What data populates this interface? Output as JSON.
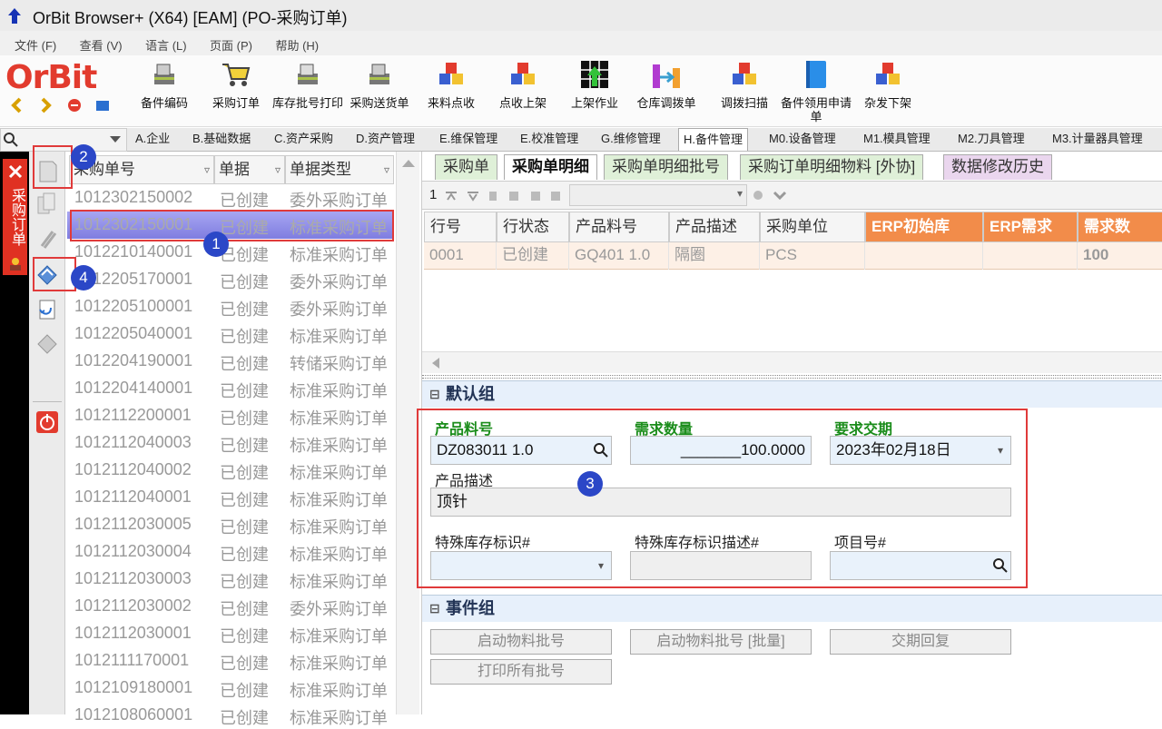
{
  "window": {
    "title": "OrBit Browser+ (X64) [EAM] (PO-采购订单)"
  },
  "menu": [
    "文件 (F)",
    "查看 (V)",
    "语言 (L)",
    "页面 (P)",
    "帮助 (H)"
  ],
  "logo": "OrBit",
  "toolbar": [
    {
      "label": "备件编码",
      "icon": "scanner-icon"
    },
    {
      "label": "采购订单",
      "icon": "cart-icon"
    },
    {
      "label": "库存批号打印",
      "icon": "print-scanner-icon"
    },
    {
      "label": "采购送货单",
      "icon": "scanner-icon"
    },
    {
      "label": "来料点收",
      "icon": "cubes-icon"
    },
    {
      "label": "点收上架",
      "icon": "cubes-icon"
    },
    {
      "label": "上架作业",
      "icon": "grid-arrow-icon"
    },
    {
      "label": "仓库调拨单",
      "icon": "transfer-icon"
    },
    {
      "label": "调拨扫描",
      "icon": "cubes-icon"
    },
    {
      "label": "备件领用申请单",
      "icon": "book-icon"
    },
    {
      "label": "杂发下架",
      "icon": "cubes-icon"
    }
  ],
  "module_tabs": [
    "A.企业",
    "B.基础数据",
    "C.资产采购",
    "D.资产管理",
    "E.维保管理",
    "E.校准管理",
    "G.维修管理",
    "H.备件管理",
    "M0.设备管理",
    "M1.模具管理",
    "M2.刀具管理",
    "M3.计量器具管理"
  ],
  "active_module_tab": "H.备件管理",
  "sidebar": {
    "vertical_label": "采购订单"
  },
  "left_table": {
    "columns": [
      "采购单号",
      "单据",
      "单据类型"
    ],
    "rows": [
      [
        "1012302150002",
        "已创建",
        "委外采购订单"
      ],
      [
        "1012302150001",
        "已创建",
        "标准采购订单"
      ],
      [
        "1012210140001",
        "已创建",
        "标准采购订单"
      ],
      [
        "1012205170001",
        "已创建",
        "委外采购订单"
      ],
      [
        "1012205100001",
        "已创建",
        "委外采购订单"
      ],
      [
        "1012205040001",
        "已创建",
        "标准采购订单"
      ],
      [
        "1012204190001",
        "已创建",
        "转储采购订单"
      ],
      [
        "1012204140001",
        "已创建",
        "标准采购订单"
      ],
      [
        "1012112200001",
        "已创建",
        "标准采购订单"
      ],
      [
        "1012112040003",
        "已创建",
        "标准采购订单"
      ],
      [
        "1012112040002",
        "已创建",
        "标准采购订单"
      ],
      [
        "1012112040001",
        "已创建",
        "标准采购订单"
      ],
      [
        "1012112030005",
        "已创建",
        "标准采购订单"
      ],
      [
        "1012112030004",
        "已创建",
        "标准采购订单"
      ],
      [
        "1012112030003",
        "已创建",
        "标准采购订单"
      ],
      [
        "1012112030002",
        "已创建",
        "委外采购订单"
      ],
      [
        "1012112030001",
        "已创建",
        "标准采购订单"
      ],
      [
        "1012111170001",
        "已创建",
        "标准采购订单"
      ],
      [
        "1012109180001",
        "已创建",
        "标准采购订单"
      ],
      [
        "1012108060001",
        "已创建",
        "标准采购订单"
      ]
    ],
    "selected_row": 1
  },
  "sub_tabs": [
    "采购单",
    "采购单明细",
    "采购单明细批号",
    "采购订单明细物料 [外协]",
    "数据修改历史"
  ],
  "active_sub_tab": "采购单明细",
  "grid_toolbar": {
    "page_indicator": "1"
  },
  "detail_grid": {
    "columns": [
      "行号",
      "行状态",
      "产品料号",
      "产品描述",
      "采购单位",
      "ERP初始库",
      "ERP需求",
      "需求数"
    ],
    "rows": [
      [
        "0001",
        "已创建",
        "GQ401 1.0",
        "隔圈",
        "PCS",
        "",
        "",
        "100"
      ]
    ]
  },
  "default_group": {
    "title": "默认组",
    "product_code_label": "产品料号",
    "product_code": "DZ083011 1.0",
    "qty_label": "需求数量",
    "qty": "_______100.0000",
    "date_label": "要求交期",
    "date": "2023年02月18日",
    "desc_label": "产品描述",
    "desc": "顶针",
    "special_stock_label": "特殊库存标识#",
    "special_stock": "",
    "special_stock_desc_label": "特殊库存标识描述#",
    "special_stock_desc": "",
    "project_label": "项目号#",
    "project": ""
  },
  "event_group": {
    "title": "事件组",
    "buttons": [
      "启动物料批号",
      "启动物料批号 [批量]",
      "交期回复",
      "打印所有批号"
    ]
  },
  "annotations": [
    "1",
    "2",
    "3",
    "4"
  ],
  "colors": {
    "logo_red": "#e23b2e",
    "erp_header": "#f28c4a",
    "highlight_red": "#e03a3a",
    "badge_blue": "#2b47c7",
    "label_green": "#1a8c1a"
  }
}
